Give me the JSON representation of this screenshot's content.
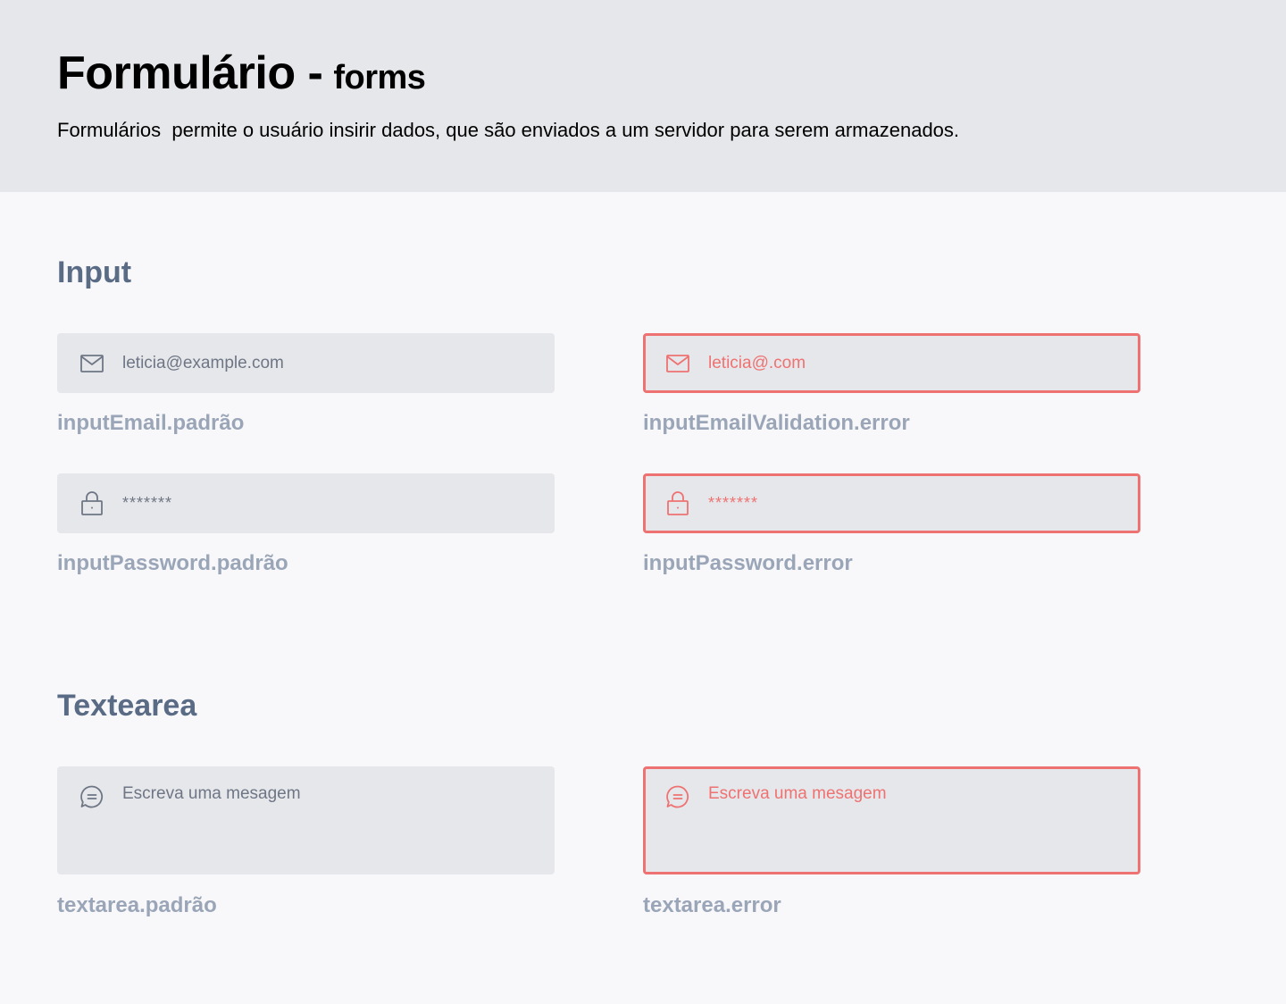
{
  "header": {
    "title": "Formulário -",
    "subtitle": "forms",
    "description": "Formulários  permite o usuário insirir dados, que são enviados a um servidor para serem armazenados."
  },
  "sections": {
    "input": {
      "title": "Input"
    },
    "textarea": {
      "title": "Textearea"
    }
  },
  "fields": {
    "email_default": {
      "value": "leticia@example.com",
      "icon": "mail-icon",
      "caption": "inputEmail.padrão"
    },
    "email_error": {
      "value": "leticia@.com",
      "icon": "mail-icon",
      "caption": "inputEmailValidation.error"
    },
    "password_default": {
      "value": "*******",
      "icon": "lock-icon",
      "caption": "inputPassword.padrão"
    },
    "password_error": {
      "value": "*******",
      "icon": "lock-icon",
      "caption": "inputPassword.error"
    },
    "textarea_default": {
      "placeholder": "Escreva uma mesagem",
      "icon": "message-icon",
      "caption": "textarea.padrão"
    },
    "textarea_error": {
      "placeholder": "Escreva uma mesagem",
      "icon": "message-icon",
      "caption": "textarea.error"
    }
  },
  "colors": {
    "header_bg": "#E6E7EA",
    "page_bg": "#F8F8FA",
    "field_bg": "#E6E7EA",
    "error": "#EE7272",
    "section_title": "#5A6B85",
    "caption": "#9AA6B8",
    "default_text": "#6E7685"
  }
}
